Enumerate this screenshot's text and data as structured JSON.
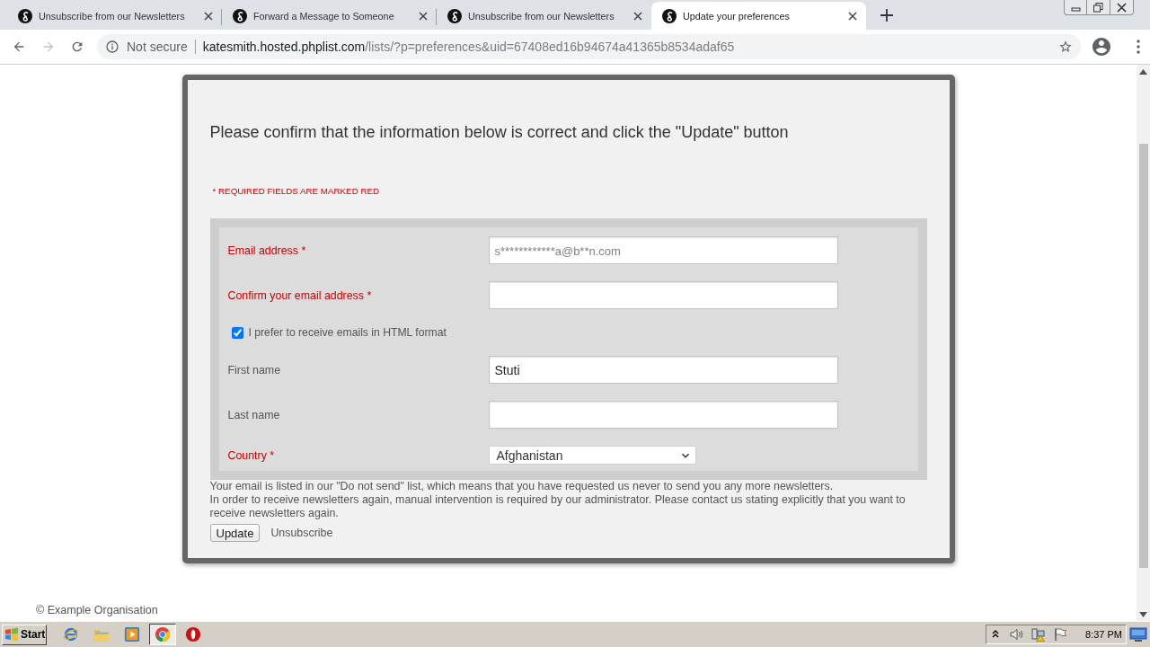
{
  "browser": {
    "tabs": [
      {
        "title": "Unsubscribe from our Newsletters",
        "selected": false
      },
      {
        "title": "Forward a Message to Someone",
        "selected": false
      },
      {
        "title": "Unsubscribe from our Newsletters",
        "selected": false
      },
      {
        "title": "Update your preferences",
        "selected": true
      }
    ],
    "address_bar": {
      "security_label": "Not secure",
      "host": "katesmith.hosted.phplist.com",
      "path": "/lists/?p=preferences&uid=67408ed16b94674a41365b8534adaf65"
    }
  },
  "page": {
    "heading": "Please confirm that the information below is correct and click the \"Update\" button",
    "required_note": "* REQUIRED FIELDS ARE MARKED RED",
    "fields": [
      {
        "kind": "text",
        "label": "Email address *",
        "required": true,
        "placeholder": "s************a@b**n.com"
      },
      {
        "kind": "text",
        "label": "Confirm your email address *",
        "required": true
      },
      {
        "kind": "checkbox",
        "label": "I prefer to receive emails in HTML format",
        "checked": true
      },
      {
        "kind": "text",
        "label": "First name",
        "required": false,
        "value": "Stuti"
      },
      {
        "kind": "text",
        "label": "Last name",
        "required": false
      },
      {
        "kind": "select",
        "label": "Country *",
        "required": true,
        "value": "Afghanistan"
      }
    ],
    "notice": [
      "Your email is listed in our \"Do not send\" list, which means that you have requested us never to send you any more newsletters.",
      "In order to receive newsletters again, manual intervention is required by our administrator. Please contact us stating explicitly that you want to receive newsletters again."
    ],
    "update_button": "Update",
    "unsubscribe_link": "Unsubscribe",
    "footer": "© Example Organisation"
  },
  "taskbar": {
    "start_button": "Start",
    "apps": [
      {
        "kind": "ie",
        "selected": false
      },
      {
        "kind": "explorer",
        "selected": false
      },
      {
        "kind": "media",
        "selected": false
      },
      {
        "kind": "chrome",
        "selected": true
      },
      {
        "kind": "opera",
        "selected": false
      }
    ],
    "clock": "8:37 PM"
  }
}
